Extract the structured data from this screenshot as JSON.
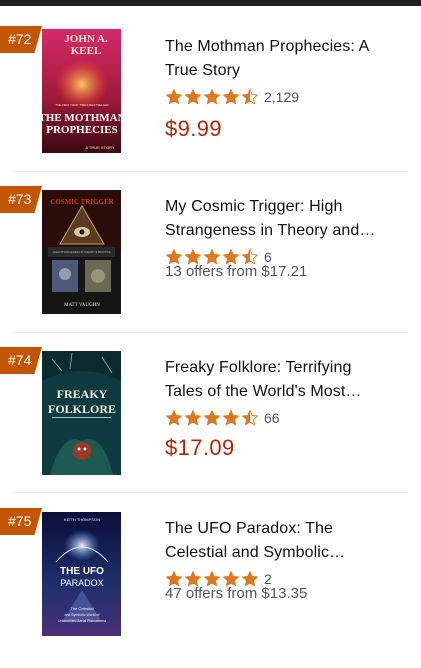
{
  "colors": {
    "accent": "#c45500",
    "price": "#b12704",
    "star": "#de7921"
  },
  "items": [
    {
      "rank": "#72",
      "title_line1": "The Mothman Prophecies: A",
      "title_line2": "True Story",
      "stars": 4.5,
      "review_count": "2,129",
      "price": "$9.99",
      "offers": "",
      "cover": {
        "top": "JOHN A. KEEL",
        "top1": "JOHN A.",
        "top2": "KEEL",
        "tag": "THE NEW YORK TIMES BESTSELLER",
        "main1": "THE MOTHMAN",
        "main2": "PROPHECIES",
        "sub": "A TRUE STORY"
      }
    },
    {
      "rank": "#73",
      "title_line1": "My Cosmic Trigger: High",
      "title_line2": "Strangeness in Theory and…",
      "stars": 4.5,
      "review_count": "6",
      "price": "",
      "offers": "13 offers from $17.21",
      "cover": {
        "top": "COSMIC TRIGGER",
        "sub": "HIGH STRANGENESS IN THEORY & PRACTICE",
        "author": "MATT VAUGHN"
      }
    },
    {
      "rank": "#74",
      "title_line1": "Freaky Folklore: Terrifying",
      "title_line2": "Tales of the World's Most…",
      "stars": 4.5,
      "review_count": "66",
      "price": "$17.09",
      "offers": "",
      "cover": {
        "main1": "FREAKY",
        "main2": "FOLKLORE"
      }
    },
    {
      "rank": "#75",
      "title_line1": "The UFO Paradox: The",
      "title_line2": "Celestial and Symbolic…",
      "stars": 5,
      "review_count": "2",
      "price": "",
      "offers": "47 offers from $13.35",
      "cover": {
        "author": "KEITH THOMPSON",
        "main1": "THE UFO",
        "main2": "PARADOX",
        "sub1": "The Celestial",
        "sub2": "and Symbolic World of",
        "sub3": "Unidentified Aerial Phenomena"
      }
    }
  ]
}
